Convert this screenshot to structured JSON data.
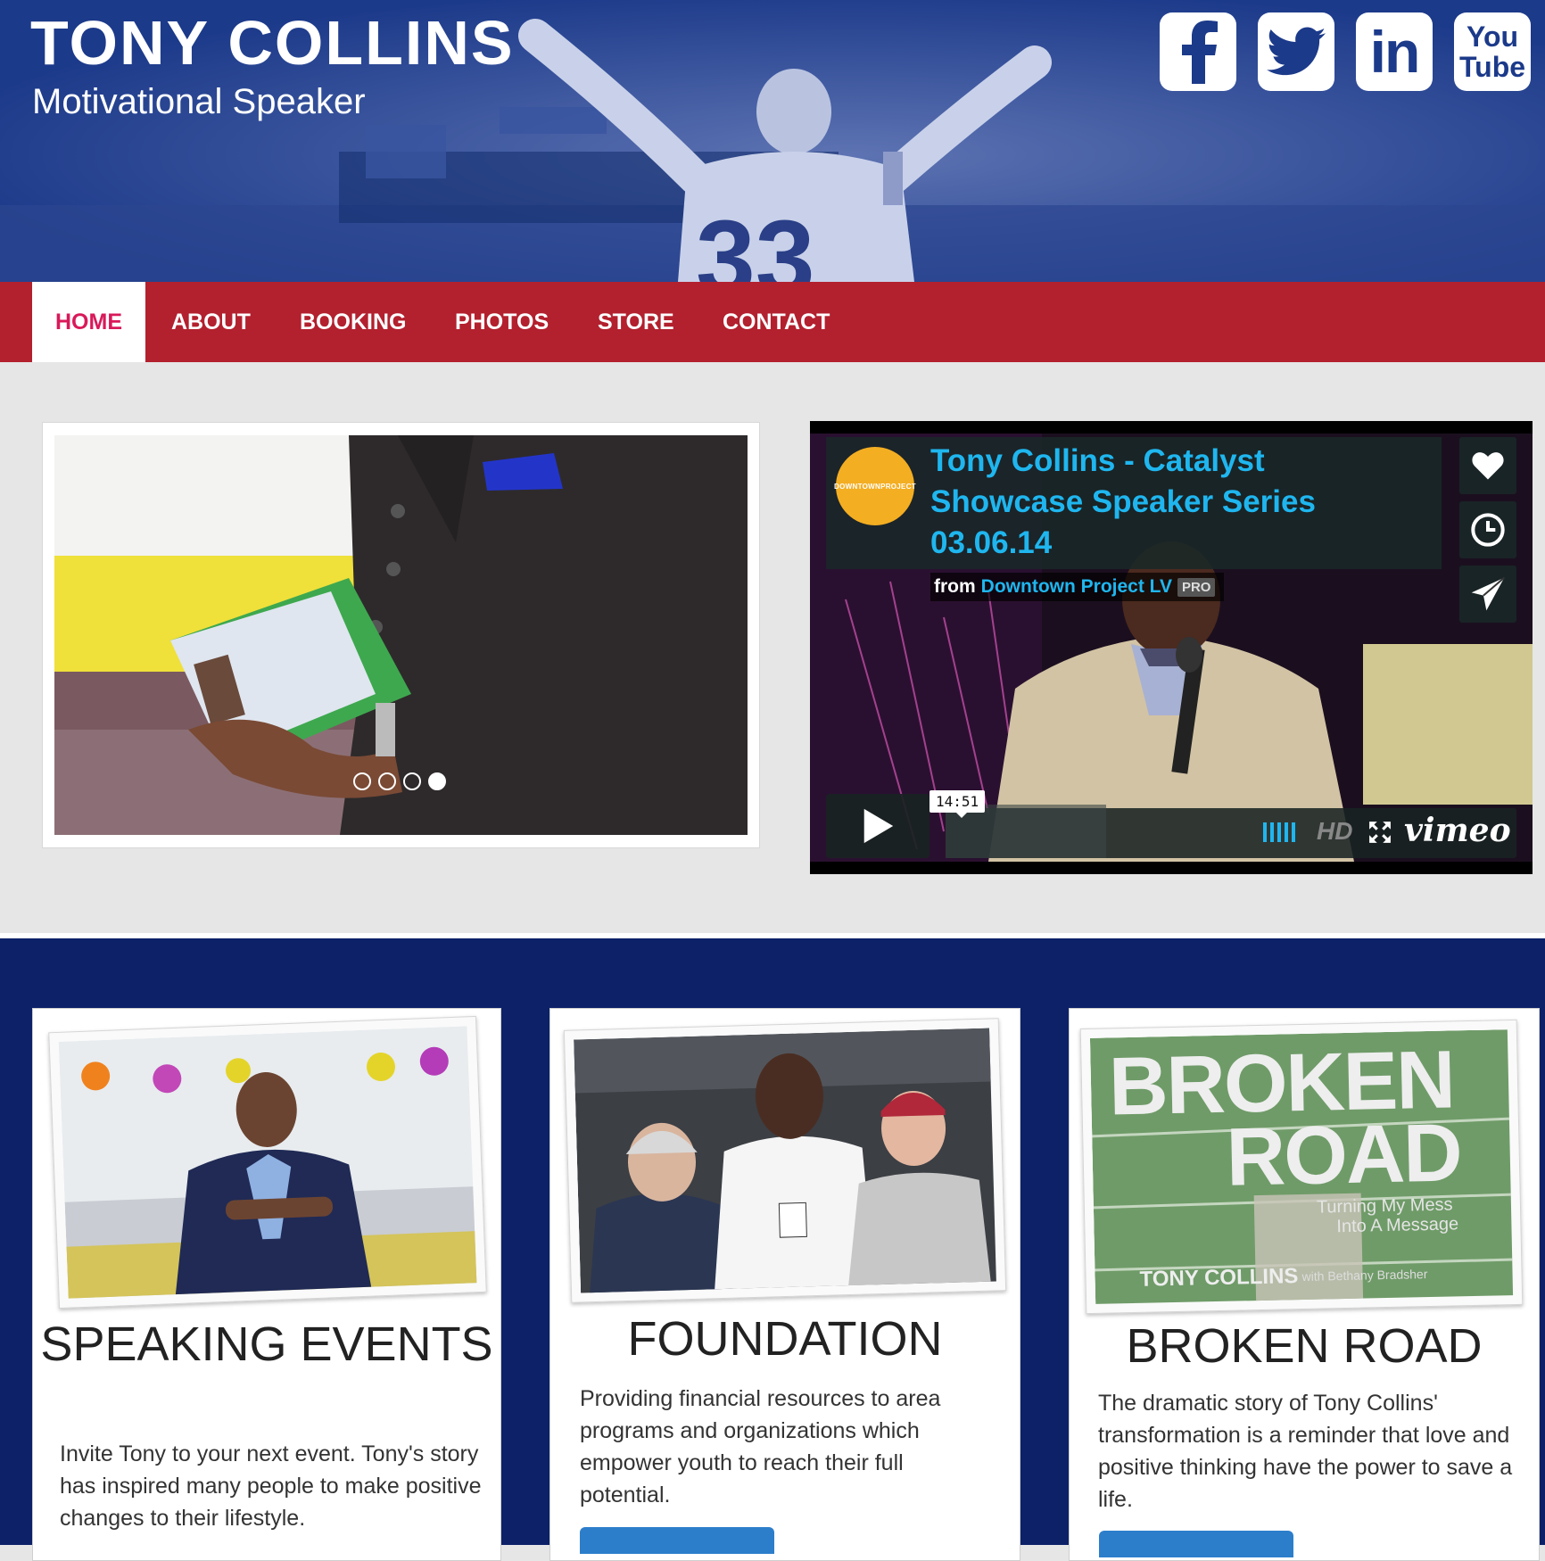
{
  "header": {
    "title": "TONY COLLINS",
    "subtitle": "Motivational Speaker",
    "social": [
      {
        "icon": "facebook-icon"
      },
      {
        "icon": "twitter-icon"
      },
      {
        "icon": "linkedin-icon",
        "text": "in"
      },
      {
        "icon": "youtube-icon",
        "text_top": "You",
        "text_bottom": "Tube"
      }
    ]
  },
  "nav": {
    "items": [
      "HOME",
      "ABOUT",
      "BOOKING",
      "PHOTOS",
      "STORE",
      "CONTACT"
    ],
    "active": "HOME"
  },
  "slider": {
    "slide_count": 4,
    "active_slide": 4
  },
  "video": {
    "logo_text": "DOWNTOWNPROJECT",
    "title": "Tony Collins - Catalyst Showcase Speaker Series 03.06.14",
    "from_label": "from",
    "author": "Downtown Project LV",
    "badge": "PRO",
    "duration": "14:51",
    "hd_label": "HD",
    "brand": "vimeo"
  },
  "features": [
    {
      "title": "SPEAKING EVENTS",
      "text": "Invite Tony to your next event. Tony's story has inspired many people to make positive changes to their lifestyle."
    },
    {
      "title": "FOUNDATION",
      "text": "Providing financial resources to area programs and organizations which empower youth to reach their full potential."
    },
    {
      "title": "BROKEN ROAD",
      "text": "The dramatic story of Tony Collins' transformation is a reminder that love and positive thinking have the power to save a life.",
      "book": {
        "line1": "BROKEN",
        "line2": "ROAD",
        "tagline1": "Turning My Mess",
        "tagline2": "Into A Message",
        "author": "TONY COLLINS",
        "coauthor": "with Bethany Bradsher"
      }
    }
  ],
  "colors": {
    "header_blue": "#1c3a8a",
    "nav_red": "#b3202e",
    "active_pink": "#d9195a",
    "features_navy": "#0d2169",
    "vimeo_blue": "#1fb6ef",
    "button_blue": "#2c7ecb"
  }
}
